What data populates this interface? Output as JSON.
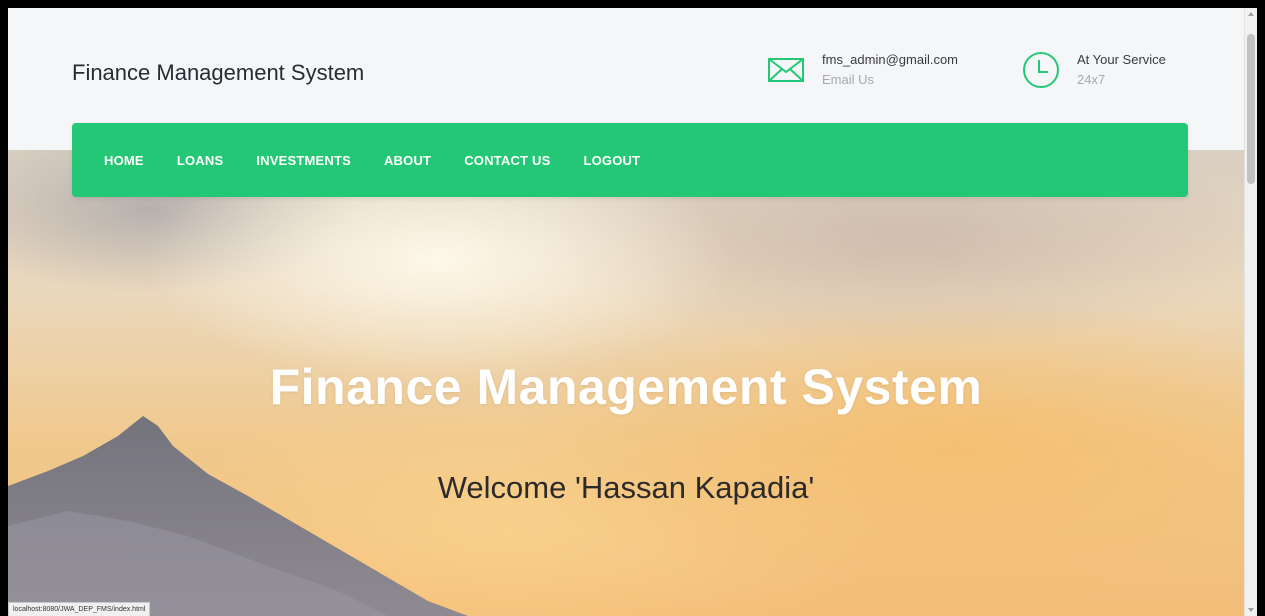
{
  "header": {
    "brand": "Finance Management System",
    "email": {
      "address": "fms_admin@gmail.com",
      "label": "Email Us",
      "icon": "envelope-icon"
    },
    "service": {
      "title": "At Your Service",
      "hours": "24x7",
      "icon": "clock-icon"
    }
  },
  "nav": {
    "items": [
      {
        "label": "HOME"
      },
      {
        "label": "LOANS"
      },
      {
        "label": "INVESTMENTS"
      },
      {
        "label": "ABOUT"
      },
      {
        "label": "CONTACT US"
      },
      {
        "label": "LOGOUT"
      }
    ]
  },
  "hero": {
    "title": "Finance Management System",
    "welcome": "Welcome 'Hassan Kapadia'"
  },
  "status_bar": {
    "url": "localhost:8080/JWA_DEP_FMS/index.html"
  },
  "colors": {
    "accent": "#24c775",
    "text_dark": "#2b2b33",
    "muted": "#a8a8ae"
  }
}
